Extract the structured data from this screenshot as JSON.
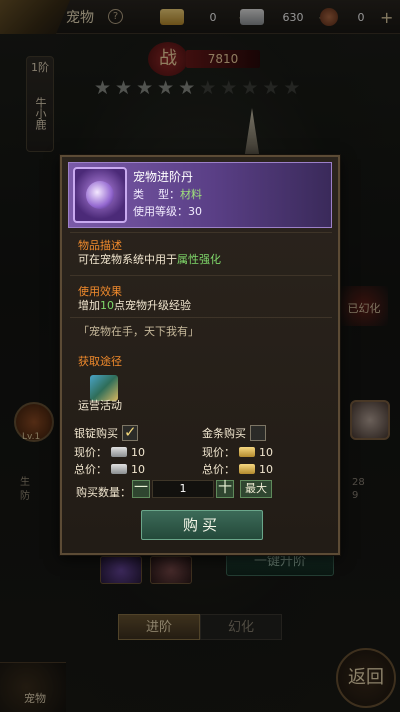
{
  "header": {
    "title": "宠物",
    "help": "?",
    "currencies": [
      {
        "name": "gold-bar",
        "amount": "0",
        "plus": "+"
      },
      {
        "name": "silver-bar",
        "amount": "630",
        "plus": "+"
      },
      {
        "name": "coin",
        "amount": "0",
        "plus": "+"
      }
    ]
  },
  "background": {
    "side_tag_tier": "1阶",
    "side_tag_name": "牛小鹿",
    "battle_label": "战",
    "power": "7810",
    "stars_on": 5,
    "stars_total": 10,
    "side_left_level": "Lv.1",
    "side_left_text": "生\n防",
    "side_right_nums": "28\n9",
    "evolve_label": "已幻化",
    "upgrade_all": "一键升阶",
    "tabs": [
      {
        "label": "进阶"
      },
      {
        "label": "幻化"
      }
    ],
    "pet_corner": "宠物",
    "return": "返回"
  },
  "popup": {
    "item": {
      "name": "宠物进阶丹",
      "type_label": "类    型：",
      "type_value": "材料",
      "level_label": "使用等级：",
      "level_value": "30",
      "icon": "purple-orb-icon"
    },
    "description": {
      "title": "物品描述",
      "text_prefix": "可在宠物系统中用于",
      "text_highlight": "属性强化"
    },
    "effect": {
      "title": "使用效果",
      "text_prefix": "增加",
      "text_highlight": "10",
      "text_suffix": "点宠物升级经验"
    },
    "flavor": "「宠物在手，天下我有」",
    "source": {
      "title": "获取途径",
      "label": "运营活动",
      "icon": "event-icon"
    },
    "silver_buy": {
      "label": "银锭购买",
      "checked": true,
      "price_label": "现价：",
      "price": "10",
      "total_label": "总价：",
      "total": "10"
    },
    "gold_buy": {
      "label": "金条购买",
      "checked": false,
      "price_label": "现价：",
      "price": "10",
      "total_label": "总价：",
      "total": "10"
    },
    "quantity": {
      "label": "购买数量：",
      "minus": "一",
      "value": "1",
      "plus": "十",
      "max": "最大"
    },
    "buy_button": "购买"
  }
}
